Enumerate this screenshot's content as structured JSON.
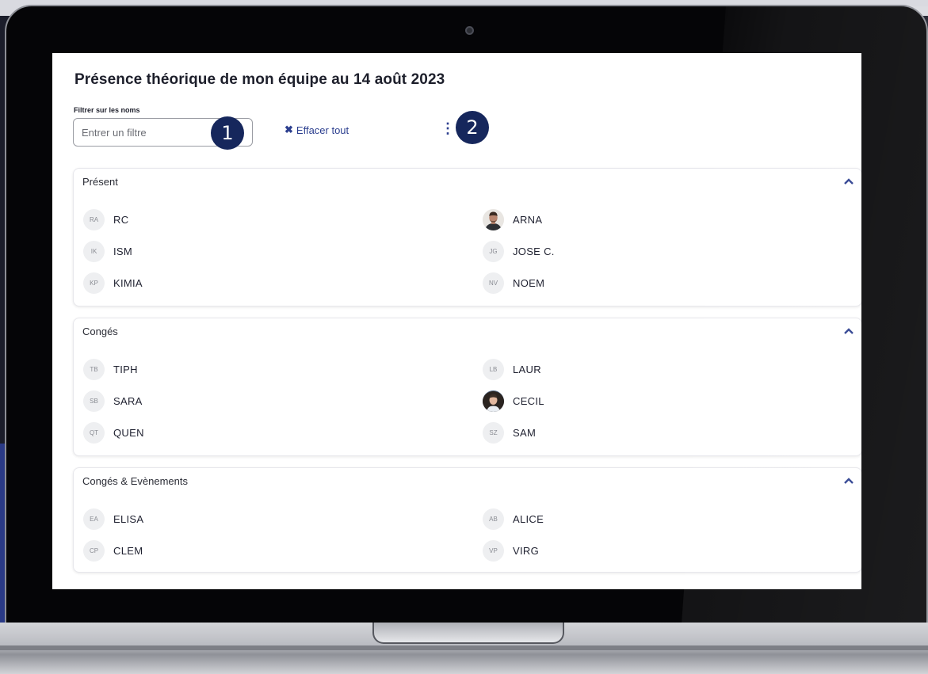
{
  "page": {
    "title": "Présence théorique de mon équipe au 14 août 2023"
  },
  "filter": {
    "label": "Filtrer sur les noms",
    "placeholder": "Entrer un filtre",
    "value": ""
  },
  "toolbar": {
    "clear_label": "Effacer tout",
    "clear_icon": "close-icon",
    "more_icon": "more-vertical-icon"
  },
  "markers": [
    "1",
    "2"
  ],
  "colors": {
    "accent": "#2c3f8f",
    "marker": "#16275c",
    "avatar_bg": "#eeeff1"
  },
  "sections": [
    {
      "title": "Présent",
      "people": [
        {
          "initials": "RA",
          "name": "RC"
        },
        {
          "initials": "",
          "name": "ARNA",
          "photo": true
        },
        {
          "initials": "IK",
          "name": "ISM"
        },
        {
          "initials": "JG",
          "name": "JOSE C."
        },
        {
          "initials": "KP",
          "name": "KIMIA"
        },
        {
          "initials": "NV",
          "name": "NOEM"
        }
      ]
    },
    {
      "title": "Congés",
      "people": [
        {
          "initials": "TB",
          "name": "TIPH"
        },
        {
          "initials": "LB",
          "name": "LAUR"
        },
        {
          "initials": "SB",
          "name": "SARA"
        },
        {
          "initials": "",
          "name": "CECIL",
          "photo": true
        },
        {
          "initials": "QT",
          "name": "QUEN"
        },
        {
          "initials": "SZ",
          "name": "SAM"
        }
      ]
    },
    {
      "title": "Congés & Evènements",
      "people": [
        {
          "initials": "EA",
          "name": "ELISA"
        },
        {
          "initials": "AB",
          "name": "ALICE"
        },
        {
          "initials": "CP",
          "name": "CLEM"
        },
        {
          "initials": "VP",
          "name": "VIRG"
        }
      ]
    }
  ]
}
